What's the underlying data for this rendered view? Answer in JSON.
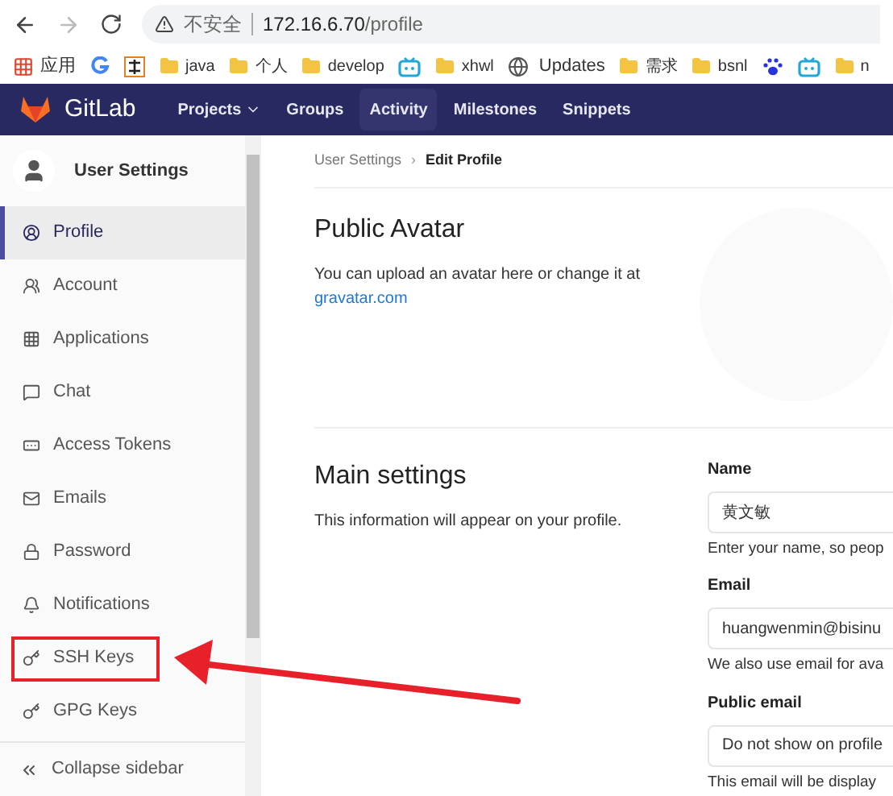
{
  "browser": {
    "security_label": "不安全",
    "url_host": "172.16.6.70",
    "url_path": "/profile"
  },
  "bookmarks": [
    {
      "kind": "apps",
      "label": "应用"
    },
    {
      "kind": "google"
    },
    {
      "kind": "zhi"
    },
    {
      "kind": "folder",
      "label": "java"
    },
    {
      "kind": "folder",
      "label": "个人"
    },
    {
      "kind": "folder",
      "label": "develop"
    },
    {
      "kind": "tv"
    },
    {
      "kind": "folder",
      "label": "xhwl"
    },
    {
      "kind": "globe",
      "label": "Updates"
    },
    {
      "kind": "folder",
      "label": "需求"
    },
    {
      "kind": "folder",
      "label": "bsnl"
    },
    {
      "kind": "paw"
    },
    {
      "kind": "tv"
    },
    {
      "kind": "folder",
      "label": "n"
    }
  ],
  "navbar": {
    "brand": "GitLab",
    "items": [
      {
        "label": "Projects",
        "dropdown": true,
        "selected": false
      },
      {
        "label": "Groups",
        "dropdown": false,
        "selected": false
      },
      {
        "label": "Activity",
        "dropdown": false,
        "selected": true
      },
      {
        "label": "Milestones",
        "dropdown": false,
        "selected": false
      },
      {
        "label": "Snippets",
        "dropdown": false,
        "selected": false
      }
    ]
  },
  "sidebar": {
    "title": "User Settings",
    "items": [
      {
        "kind": "profile",
        "label": "Profile",
        "selected": true
      },
      {
        "kind": "account",
        "label": "Account",
        "selected": false
      },
      {
        "kind": "applications",
        "label": "Applications",
        "selected": false
      },
      {
        "kind": "chat",
        "label": "Chat",
        "selected": false
      },
      {
        "kind": "token",
        "label": "Access Tokens",
        "selected": false
      },
      {
        "kind": "email",
        "label": "Emails",
        "selected": false
      },
      {
        "kind": "lock",
        "label": "Password",
        "selected": false
      },
      {
        "kind": "bell",
        "label": "Notifications",
        "selected": false
      },
      {
        "kind": "key",
        "label": "SSH Keys",
        "selected": false,
        "highlighted": true
      },
      {
        "kind": "key",
        "label": "GPG Keys",
        "selected": false,
        "highlighted": false
      }
    ],
    "collapse": "Collapse sidebar"
  },
  "breadcrumb": [
    "User Settings",
    "›",
    "Edit Profile"
  ],
  "avatar_section": {
    "title": "Public Avatar",
    "text": "You can upload an avatar here or change it at",
    "link": "gravatar.com"
  },
  "main_settings": {
    "title": "Main settings",
    "text": "This information will appear on your profile.",
    "fields": [
      {
        "label": "Name",
        "value": "黄文敏",
        "help": "Enter your name, so peop"
      },
      {
        "label": "Email",
        "value": "huangwenmin@bisinu",
        "help": "We also use email for ava"
      },
      {
        "label": "Public email",
        "value": "Do not show on profile",
        "help": "This email will be display"
      }
    ]
  }
}
